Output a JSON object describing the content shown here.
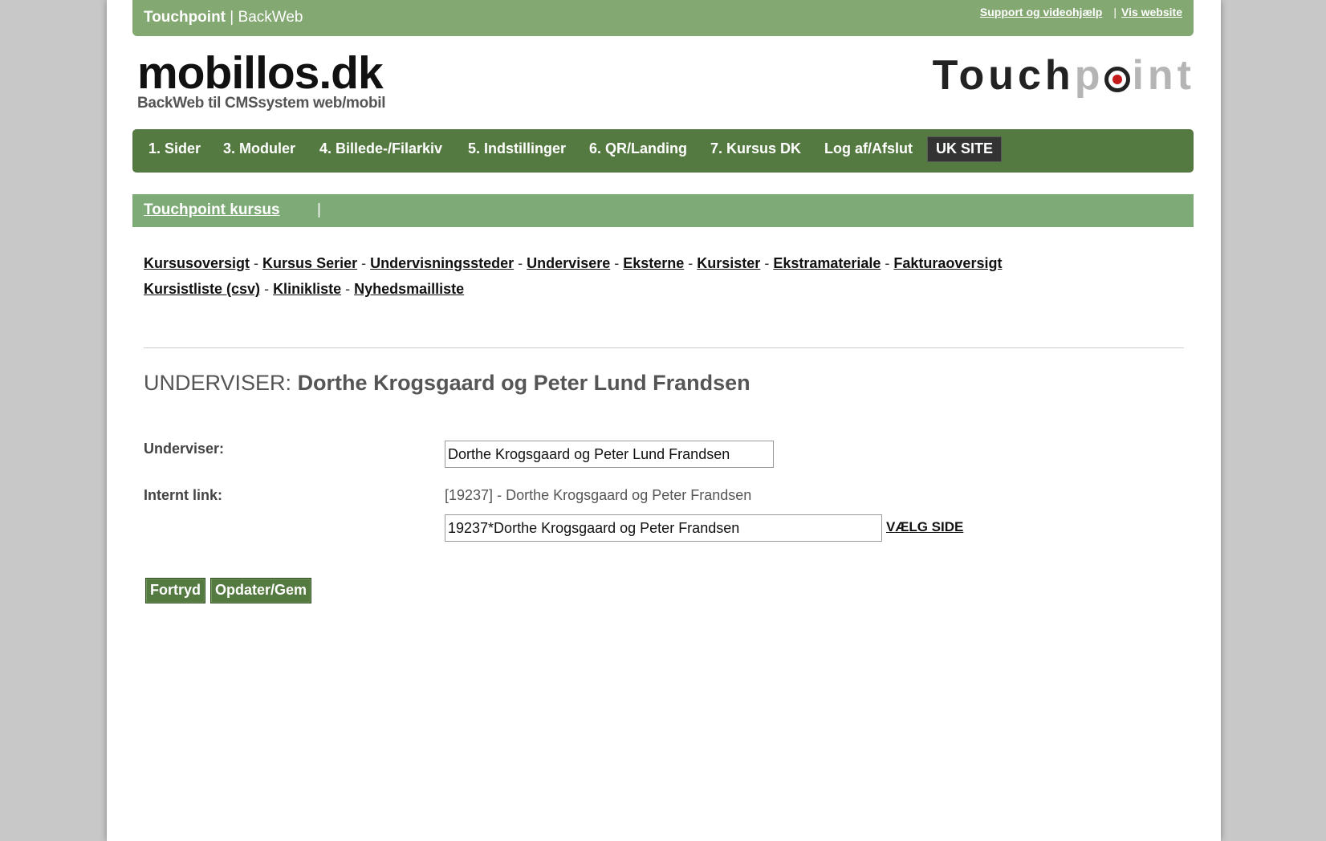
{
  "topbar": {
    "brand_bold": "Touchpoint",
    "brand_sep": " | ",
    "brand_rest": "BackWeb",
    "support_link": "Support og videohjælp",
    "sep": "|",
    "website_link": "Vis website"
  },
  "logo_left": {
    "main": "mobillos.dk",
    "tagline": "BackWeb til CMSsystem web/mobil"
  },
  "logo_right": {
    "part1": "Touch",
    "part2": "p",
    "part3": "int"
  },
  "nav": {
    "items": [
      "1. Sider",
      "3. Moduler",
      "4. Billede-/Filarkiv",
      "5. Indstillinger",
      "6. QR/Landing",
      "7. Kursus DK",
      "Log af/Afslut"
    ],
    "uk_site": "UK SITE"
  },
  "subbar": {
    "title": "Touchpoint kursus",
    "pipe": "|"
  },
  "links": {
    "row1": [
      "Kursusoversigt",
      "Kursus Serier",
      "Undervisningssteder",
      "Undervisere",
      "Eksterne",
      "Kursister",
      "Ekstramateriale",
      "Fakturaoversigt"
    ],
    "row2": [
      "Kursistliste (csv)",
      "Klinikliste",
      "Nyhedsmailliste"
    ],
    "separator": "-"
  },
  "heading": {
    "prefix": "UNDERVISER:",
    "name": "Dorthe Krogsgaard og Peter Lund Frandsen"
  },
  "form": {
    "underviser_label": "Underviser:",
    "underviser_value": "Dorthe Krogsgaard og Peter Lund Frandsen",
    "internt_label": "Internt link:",
    "internt_id": "[19237]",
    "internt_sep": "-",
    "internt_name": "Dorthe Krogsgaard og Peter Frandsen",
    "internt_value": "19237*Dorthe Krogsgaard og Peter Frandsen",
    "choose_page": "VÆLG SIDE"
  },
  "buttons": {
    "cancel": "Fortryd",
    "save": "Opdater/Gem"
  },
  "colors": {
    "topbar": "#84a872",
    "nav": "#557a41",
    "subbar": "#7daa76",
    "uk_button": "#333333",
    "logo_dot": "#c41a1a"
  }
}
